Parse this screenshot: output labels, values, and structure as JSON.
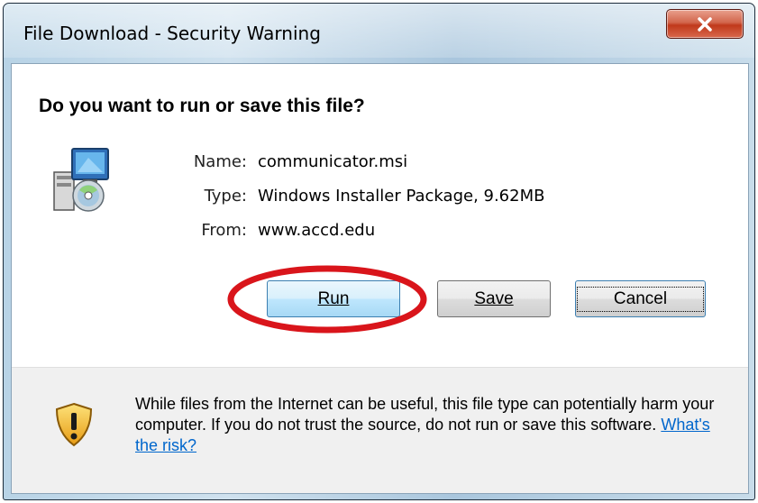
{
  "window": {
    "title": "File Download - Security Warning",
    "close_label": "x"
  },
  "dialog": {
    "heading": "Do you want to run or save this file?",
    "file": {
      "name_label": "Name:",
      "name_value": "communicator.msi",
      "type_label": "Type:",
      "type_value": "Windows Installer Package, 9.62MB",
      "from_label": "From:",
      "from_value": "www.accd.edu"
    },
    "buttons": {
      "run_label": "Run",
      "save_label": "Save",
      "cancel_label": "Cancel"
    },
    "warning": {
      "text": "While files from the Internet can be useful, this file type can potentially harm your computer. If you do not trust the source, do not run or save this software.",
      "link_label": "What's the risk?"
    }
  },
  "icons": {
    "title_close": "close-icon",
    "file": "installer-package-icon",
    "warning": "security-shield-icon"
  },
  "colors": {
    "annotation_circle": "#d9151b",
    "link": "#0066cc",
    "close_button": "#c8452a"
  }
}
